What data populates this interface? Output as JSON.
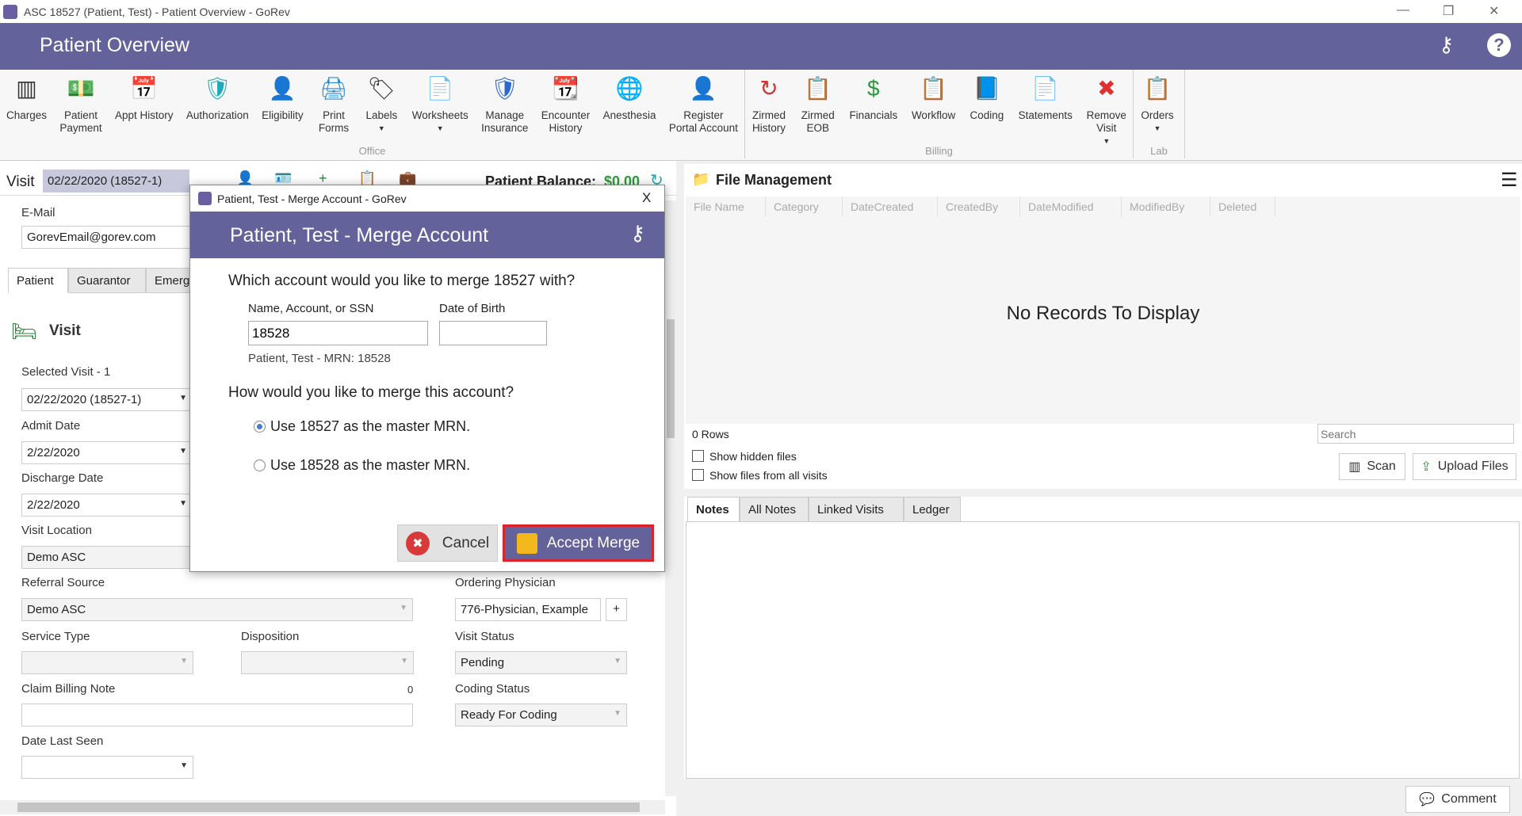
{
  "window": {
    "title": "ASC 18527 (Patient, Test) - Patient Overview - GoRev",
    "minimize": "—",
    "restore": "❐",
    "close": "✕"
  },
  "header": {
    "title": "Patient Overview"
  },
  "ribbon": {
    "groups": [
      {
        "label": "Office",
        "items": [
          {
            "label": "Charges",
            "icon": "barcode-icon",
            "glyph": "▥",
            "color": "#333"
          },
          {
            "label": "Patient\nPayment",
            "icon": "payment-icon",
            "glyph": "💵",
            "color": "#2a8a3a"
          },
          {
            "label": "Appt History",
            "icon": "calendar-clock-icon",
            "glyph": "📅",
            "color": "#c33"
          },
          {
            "label": "Authorization",
            "icon": "shield-clipboard-icon",
            "glyph": "🛡",
            "color": "#2ab"
          },
          {
            "label": "Eligibility",
            "icon": "user-check-icon",
            "glyph": "👤",
            "color": "#333"
          },
          {
            "label": "Print\nForms",
            "icon": "printer-icon",
            "glyph": "🖨",
            "color": "#2a8ad0"
          },
          {
            "label": "Labels",
            "icon": "tag-icon",
            "glyph": "🏷",
            "color": "#333",
            "dropdown": true
          },
          {
            "label": "Worksheets",
            "icon": "worksheet-icon",
            "glyph": "📄",
            "color": "#e07020",
            "dropdown": true
          },
          {
            "label": "Manage\nInsurance",
            "icon": "insurance-icon",
            "glyph": "🛡",
            "color": "#2a6ad0"
          },
          {
            "label": "Encounter\nHistory",
            "icon": "encounter-history-icon",
            "glyph": "📆",
            "color": "#2a8a3a"
          },
          {
            "label": "Anesthesia",
            "icon": "anesthesia-icon",
            "glyph": "🌐",
            "color": "#1a5ac0"
          },
          {
            "label": "Register\nPortal Account",
            "icon": "user-add-icon",
            "glyph": "👤",
            "color": "#333"
          }
        ]
      },
      {
        "label": "Billing",
        "items": [
          {
            "label": "Zirmed\nHistory",
            "icon": "refresh-history-icon",
            "glyph": "↻",
            "color": "#c33"
          },
          {
            "label": "Zirmed\nEOB",
            "icon": "eob-icon",
            "glyph": "📋",
            "color": "#e07020"
          },
          {
            "label": "Financials",
            "icon": "dollar-icon",
            "glyph": "$",
            "color": "#2a9a3a"
          },
          {
            "label": "Workflow",
            "icon": "workflow-icon",
            "glyph": "📋",
            "color": "#2a6ad0"
          },
          {
            "label": "Coding",
            "icon": "coding-icon",
            "glyph": "📘",
            "color": "#1a5ac0"
          },
          {
            "label": "Statements",
            "icon": "statements-icon",
            "glyph": "📄",
            "color": "#333"
          },
          {
            "label": "Remove\nVisit",
            "icon": "remove-icon",
            "glyph": "✖",
            "color": "#e03030",
            "dropdown": true
          }
        ]
      },
      {
        "label": "Lab",
        "items": [
          {
            "label": "Orders",
            "icon": "orders-icon",
            "glyph": "📋",
            "color": "#e07020",
            "dropdown": true
          }
        ]
      }
    ]
  },
  "visitbar": {
    "label": "Visit",
    "value": "02/22/2020 (18527-1)",
    "balance_label": "Patient Balance:",
    "balance": "$0.00"
  },
  "left": {
    "email_label": "E-Mail",
    "email": "GorevEmail@gorev.com",
    "tabs": [
      "Patient",
      "Guarantor",
      "Emerg"
    ],
    "section": "Visit",
    "selected_visit_label": "Selected Visit - 1",
    "selected_visit": "02/22/2020 (18527-1)",
    "admit_label": "Admit Date",
    "admit": "2/22/2020",
    "discharge_label": "Discharge Date",
    "discharge": "2/22/2020",
    "location_label": "Visit Location",
    "location": "Demo ASC",
    "referral_label": "Referral Source",
    "referral": "Demo ASC",
    "physician_label": "Ordering Physician",
    "physician": "776-Physician, Example",
    "add": "+",
    "service_label": "Service Type",
    "disposition_label": "Disposition",
    "status_label": "Visit Status",
    "status": "Pending",
    "note_label": "Claim Billing Note",
    "note_count": "0",
    "coding_label": "Coding Status",
    "coding": "Ready For Coding",
    "last_seen_label": "Date Last Seen"
  },
  "files": {
    "title": "File Management",
    "columns": [
      "File Name",
      "Category",
      "DateCreated",
      "CreatedBy",
      "DateModified",
      "ModifiedBy",
      "Deleted"
    ],
    "empty": "No Records To Display",
    "rows": "0 Rows",
    "search_placeholder": "Search",
    "show_hidden": "Show hidden files",
    "show_all": "Show files from all visits",
    "scan": "Scan",
    "upload": "Upload Files"
  },
  "notes": {
    "tabs": [
      "Notes",
      "All Notes",
      "Linked Visits",
      "Ledger"
    ],
    "comment": "Comment"
  },
  "dialog": {
    "window_title": "Patient, Test - Merge Account - GoRev",
    "close": "X",
    "title": "Patient, Test - Merge Account",
    "question": "Which account would you like to merge 18527 with?",
    "search_label": "Name, Account, or SSN",
    "search_value": "18528",
    "dob_label": "Date of Birth",
    "dob_value": "",
    "match": "Patient, Test - MRN: 18528",
    "how": "How would you like to merge this account?",
    "options": [
      {
        "label": "Use 18527 as the master MRN.",
        "selected": true
      },
      {
        "label": "Use 18528 as the master MRN.",
        "selected": false
      }
    ],
    "cancel": "Cancel",
    "accept": "Accept Merge",
    "accent": "#e0202a"
  }
}
